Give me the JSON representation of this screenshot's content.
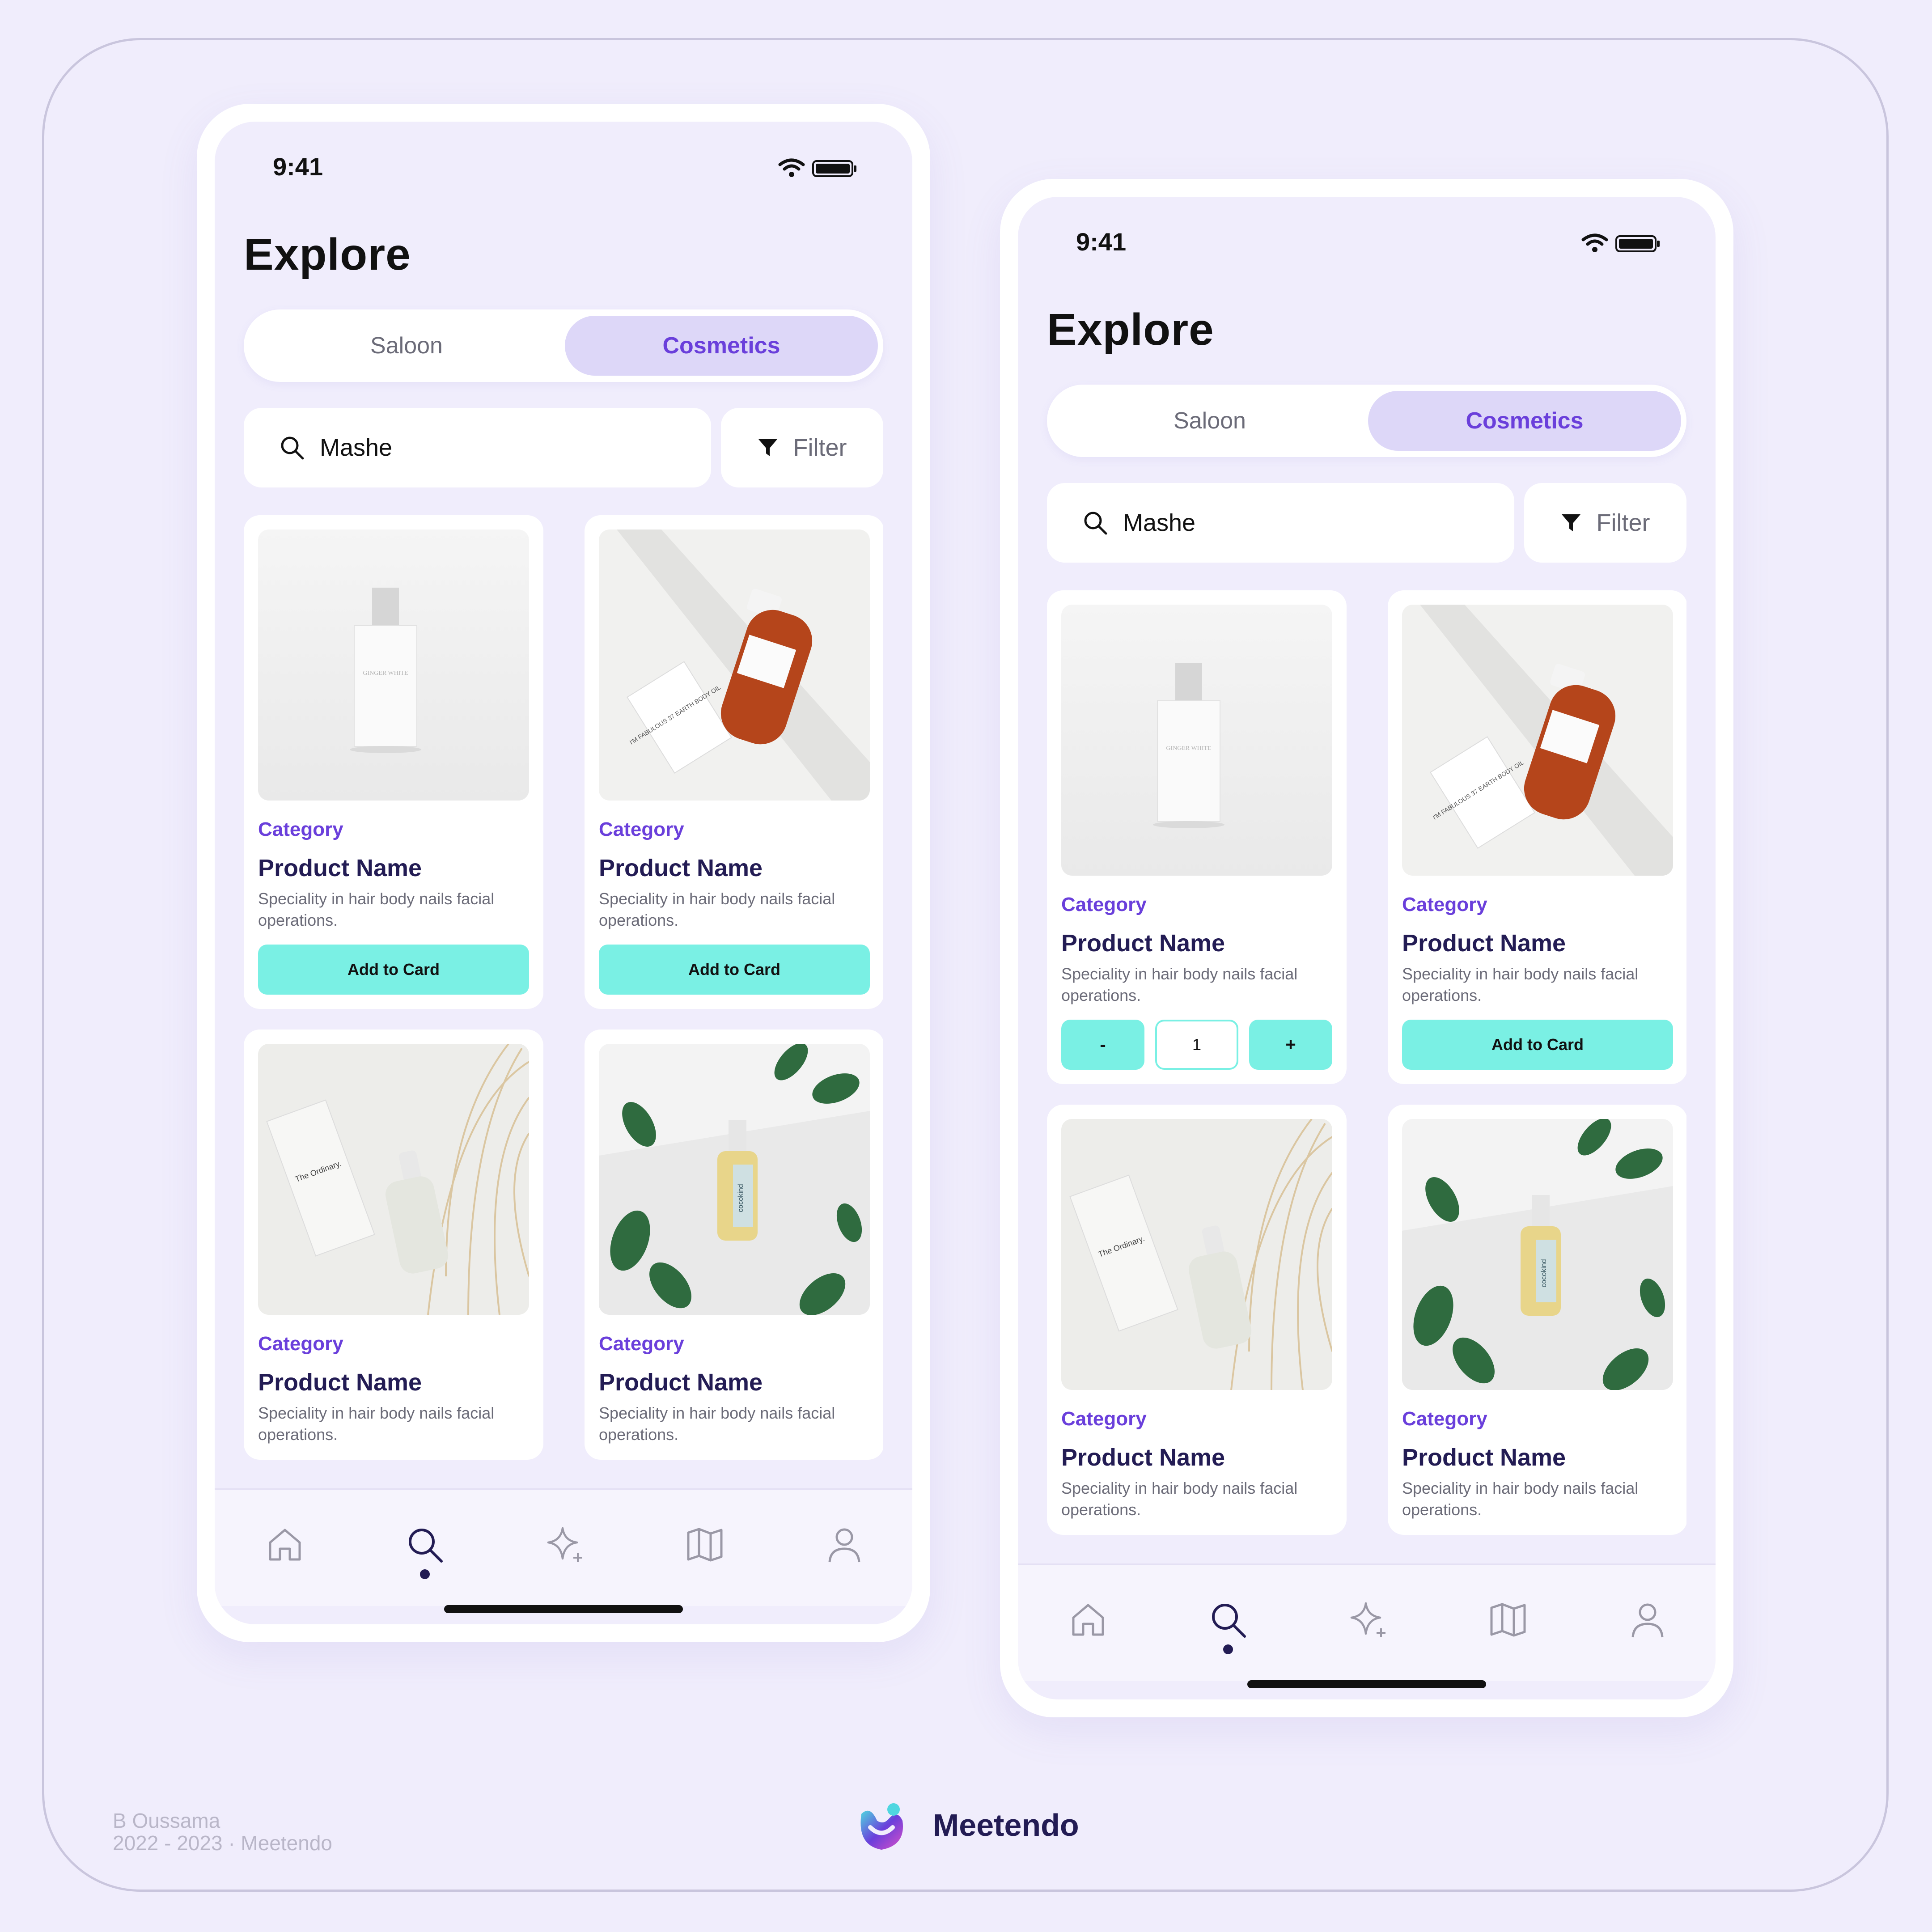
{
  "colors": {
    "background": "#F0EDFC",
    "accent": "#6A3FDB",
    "segment_selected_bg": "#DDD7F8",
    "button": "#7AF0E4",
    "title_dark": "#231C54"
  },
  "phones": [
    {
      "status": {
        "time": "9:41",
        "icons": [
          "wifi-icon",
          "battery-icon"
        ]
      },
      "title": "Explore",
      "segments": [
        "Saloon",
        "Cosmetics"
      ],
      "selected_segment": "Cosmetics",
      "search": {
        "value": "Mashe",
        "icon": "search-icon"
      },
      "filter": {
        "label": "Filter",
        "icon": "filter-icon"
      },
      "products": [
        {
          "category": "Category",
          "name": "Product Name",
          "description": "Speciality in hair body nails facial operations.",
          "image": "white-perfume-bottle",
          "image_text": "GINGER WHITE",
          "action": "Add to Card"
        },
        {
          "category": "Category",
          "name": "Product Name",
          "description": "Speciality in hair body nails facial operations.",
          "image": "amber-body-oil-bottle",
          "image_text": "I'M FABULOUS 37 EARTH BODY OIL",
          "action": "Add to Card"
        },
        {
          "category": "Category",
          "name": "Product Name",
          "description": "Speciality in hair body nails facial operations.",
          "image": "serum-dropper-bottle",
          "image_text": "The Ordinary."
        },
        {
          "category": "Category",
          "name": "Product Name",
          "description": "Speciality in hair body nails facial operations.",
          "image": "spray-bottle-with-leaves",
          "image_text": "cocokind"
        }
      ],
      "tabbar": [
        "home-icon",
        "search-icon",
        "sparkle-icon",
        "map-icon",
        "profile-icon"
      ],
      "active_tab": "search-icon"
    },
    {
      "status": {
        "time": "9:41",
        "icons": [
          "wifi-icon",
          "battery-icon"
        ]
      },
      "title": "Explore",
      "segments": [
        "Saloon",
        "Cosmetics"
      ],
      "selected_segment": "Cosmetics",
      "search": {
        "value": "Mashe",
        "icon": "search-icon"
      },
      "filter": {
        "label": "Filter",
        "icon": "filter-icon"
      },
      "products": [
        {
          "category": "Category",
          "name": "Product Name",
          "description": "Speciality in hair body nails facial operations.",
          "image": "white-perfume-bottle",
          "image_text": "GINGER WHITE",
          "stepper": {
            "minus": "-",
            "value": "1",
            "plus": "+"
          }
        },
        {
          "category": "Category",
          "name": "Product Name",
          "description": "Speciality in hair body nails facial operations.",
          "image": "amber-body-oil-bottle",
          "image_text": "I'M FABULOUS 37 EARTH BODY OIL",
          "action": "Add to Card"
        },
        {
          "category": "Category",
          "name": "Product Name",
          "description": "Speciality in hair body nails facial operations.",
          "image": "serum-dropper-bottle",
          "image_text": "The Ordinary."
        },
        {
          "category": "Category",
          "name": "Product Name",
          "description": "Speciality in hair body nails facial operations.",
          "image": "spray-bottle-with-leaves",
          "image_text": "cocokind"
        }
      ],
      "tabbar": [
        "home-icon",
        "search-icon",
        "sparkle-icon",
        "map-icon",
        "profile-icon"
      ],
      "active_tab": "search-icon"
    }
  ],
  "footer": {
    "author": "B Oussama",
    "years": "2022 - 2023 · Meetendo",
    "brand": "Meetendo",
    "logo_icon": "meetendo-logo"
  }
}
